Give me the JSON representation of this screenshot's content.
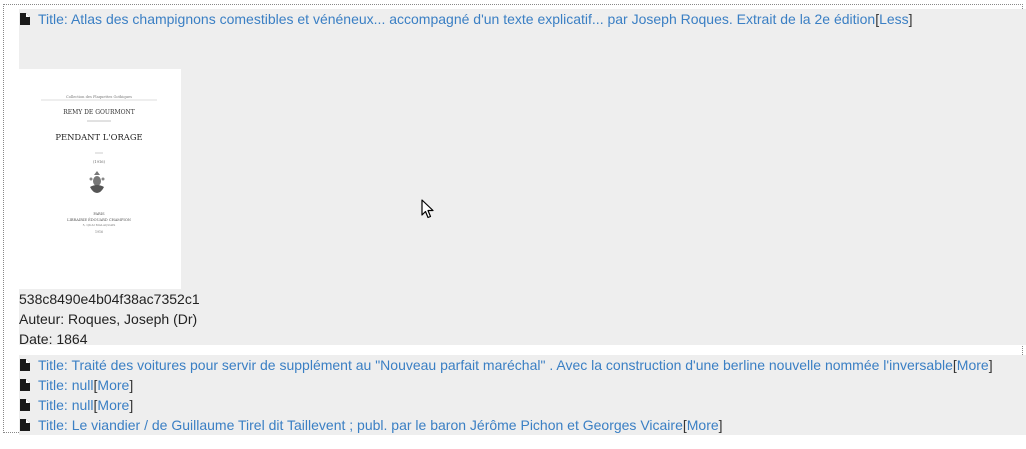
{
  "results": [
    {
      "title_prefix": "Title: ",
      "title": "Atlas des champignons comestibles et vénéneux... accompagné d'un texte explicatif... par Joseph Roques. Extrait de la 2e édition",
      "toggle_label": "Less",
      "expanded": true,
      "details": {
        "id": "538c8490e4b04f38ac7352c1",
        "author_line": "Auteur: Roques, Joseph (Dr)",
        "date_line": "Date: 1864"
      },
      "thumbnail": {
        "header_line": "Collection des Plaquettes Gothiques",
        "author": "REMY DE GOURMONT",
        "book_title": "PENDANT L'ORAGE",
        "note": "(1916)",
        "place": "PARIS",
        "publisher": "LIBRAIRIE ÉDOUARD CHAMPION",
        "address": "5, QUAI MALAQUAIS",
        "year": "1916"
      }
    },
    {
      "title_prefix": "Title: ",
      "title": "Traité des voitures pour servir de supplément au \"Nouveau parfait maréchal\" . Avec la construction d'une berline nouvelle nommée l'inversable",
      "toggle_label": "More",
      "expanded": false
    },
    {
      "title_prefix": "Title: ",
      "title": "null",
      "toggle_label": "More",
      "expanded": false
    },
    {
      "title_prefix": "Title: ",
      "title": "null",
      "toggle_label": "More",
      "expanded": false
    },
    {
      "title_prefix": "Title: ",
      "title": "Le viandier / de Guillaume Tirel dit Taillevent ; publ. par le baron Jérôme Pichon et Georges Vicaire",
      "toggle_label": "More",
      "expanded": false
    }
  ],
  "colors": {
    "link": "#3a7fc4",
    "entry_background": "#eeeeee",
    "text": "#333333"
  },
  "icons": {
    "result": "file-icon",
    "pointer": "mouse-cursor-icon"
  }
}
